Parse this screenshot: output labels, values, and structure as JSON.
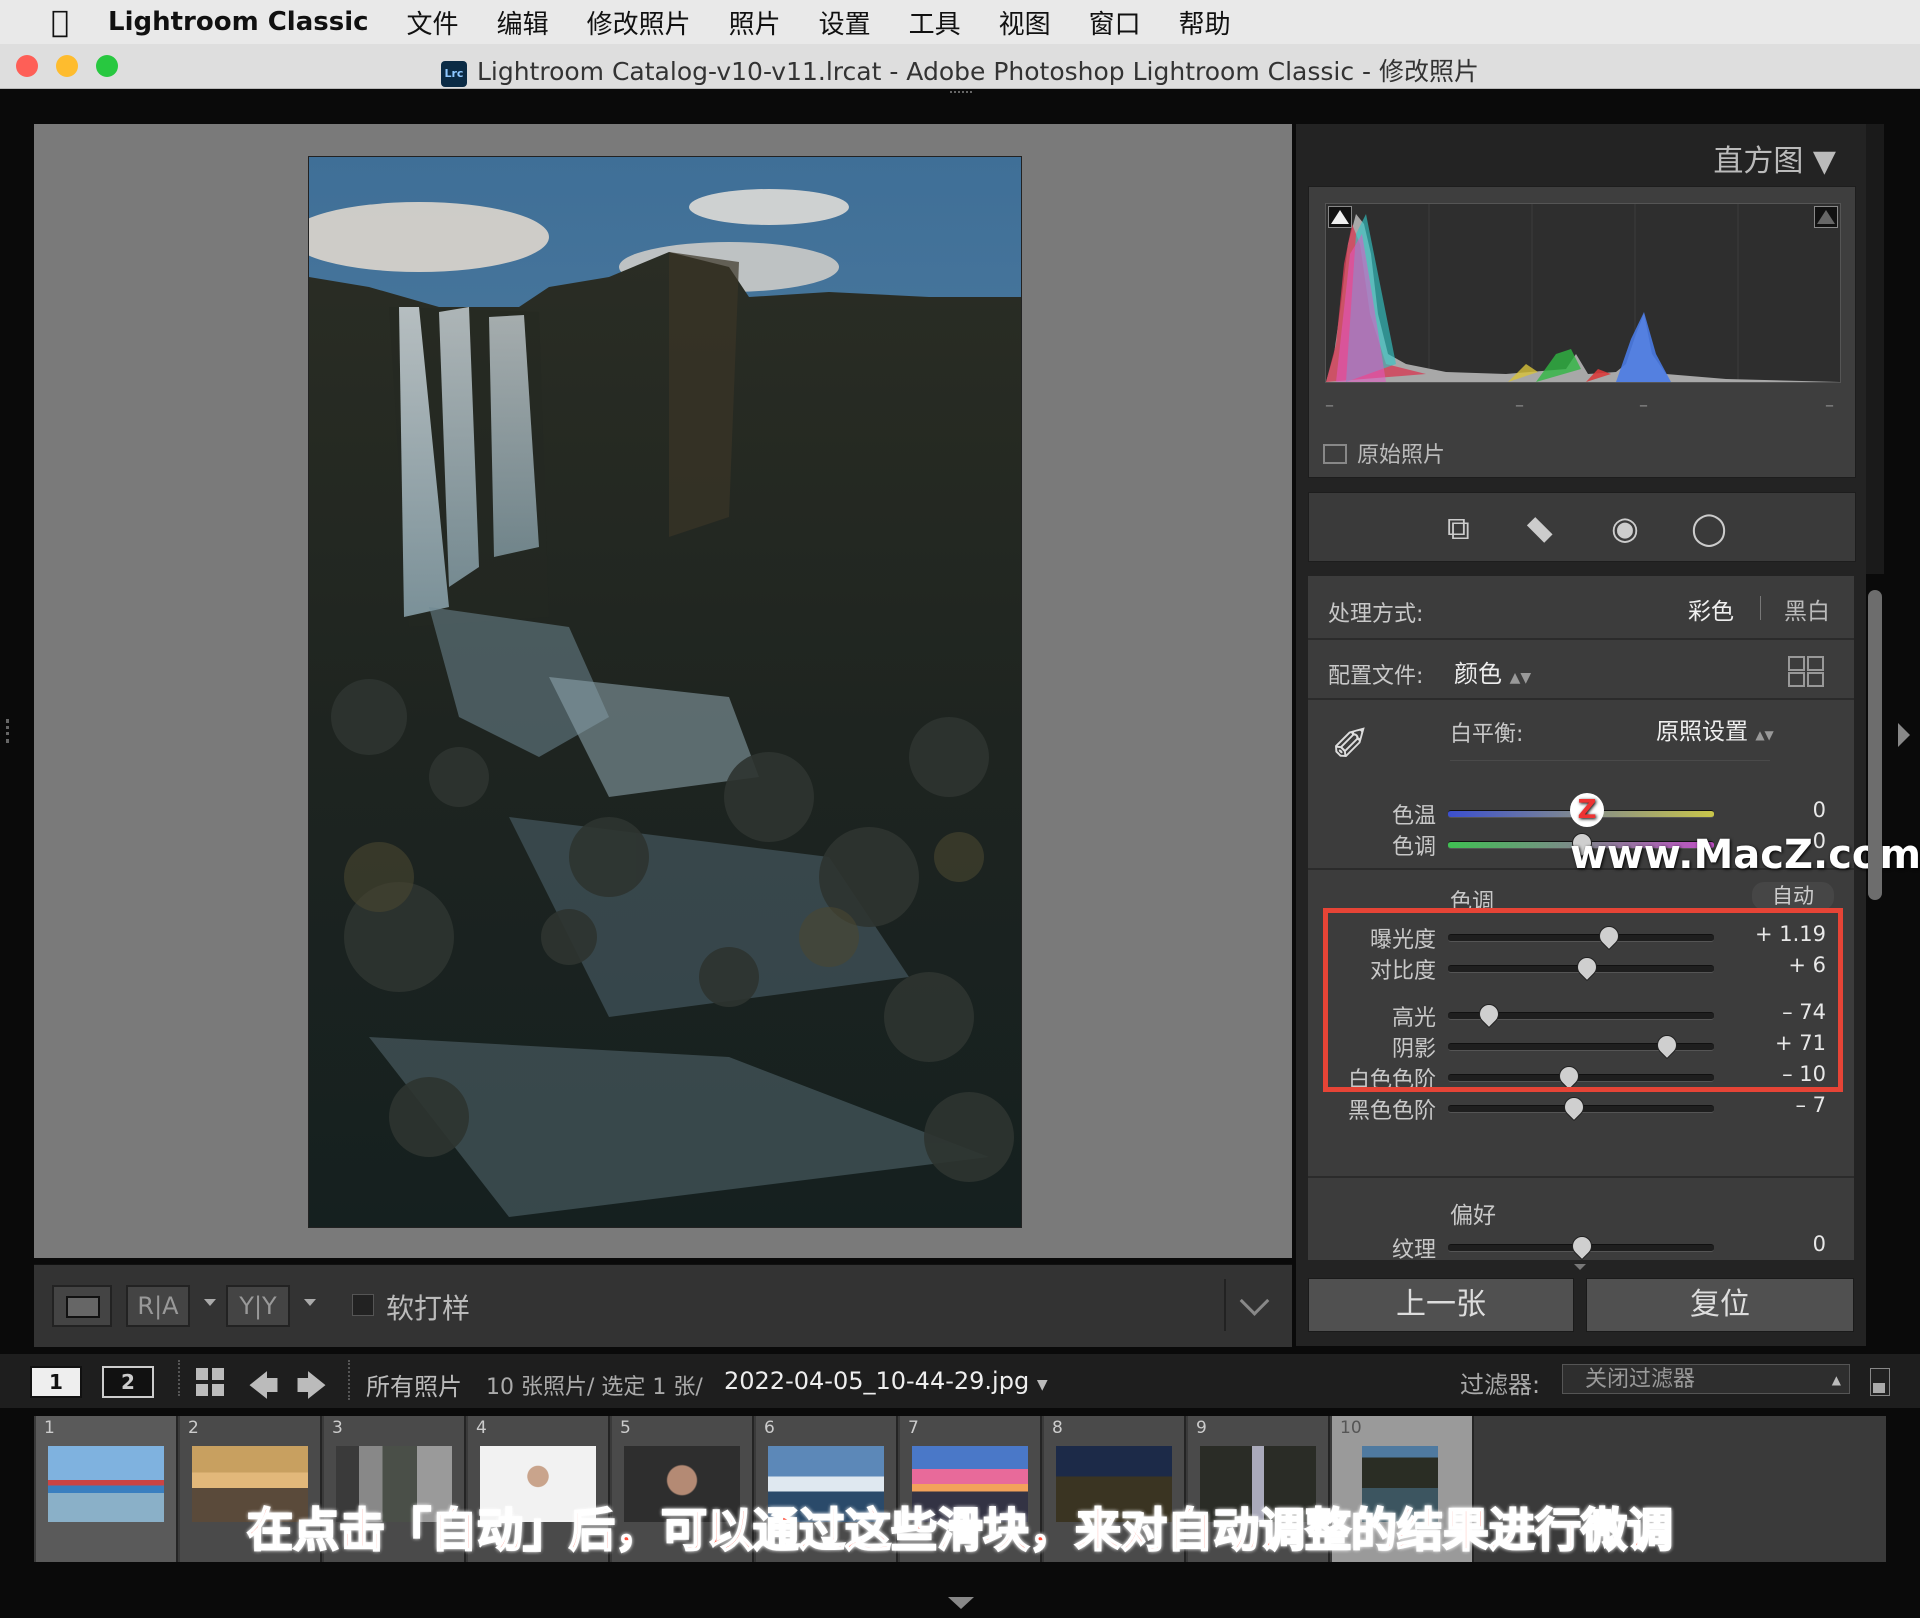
{
  "menubar": {
    "app_name": "Lightroom Classic",
    "items": [
      "文件",
      "编辑",
      "修改照片",
      "照片",
      "设置",
      "工具",
      "视图",
      "窗口",
      "帮助"
    ]
  },
  "window": {
    "icon_text": "Lrc",
    "title": "Lightroom Catalog-v10-v11.lrcat - Adobe Photoshop Lightroom Classic - 修改照片"
  },
  "right_panel": {
    "histogram_title": "直方图",
    "original_photo_label": "原始照片",
    "treatment": {
      "label": "处理方式:",
      "color": "彩色",
      "bw": "黑白"
    },
    "profile": {
      "label": "配置文件:",
      "value": "颜色"
    },
    "white_balance": {
      "label": "白平衡:",
      "value": "原照设置"
    },
    "wb_sliders": [
      {
        "label": "色温",
        "value": "0",
        "pos": 0.5
      },
      {
        "label": "色调",
        "value": "0",
        "pos": 0.5
      }
    ],
    "tone_header": "色调",
    "tone_auto": "自动",
    "tone_sliders": [
      {
        "label": "曝光度",
        "value": "+ 1.19",
        "pos": 0.6
      },
      {
        "label": "对比度",
        "value": "+ 6",
        "pos": 0.52
      },
      {
        "label": "高光",
        "value": "– 74",
        "pos": 0.15
      },
      {
        "label": "阴影",
        "value": "+ 71",
        "pos": 0.82
      },
      {
        "label": "白色色阶",
        "value": "– 10",
        "pos": 0.45
      },
      {
        "label": "黑色色阶",
        "value": "– 7",
        "pos": 0.47
      }
    ],
    "presence_header": "偏好",
    "presence_sliders": [
      {
        "label": "纹理",
        "value": "0",
        "pos": 0.5
      }
    ],
    "prev_button": "上一张",
    "reset_button": "复位"
  },
  "viewer_toolbar": {
    "compare_ra": "R|A",
    "compare_yy": "Y|Y",
    "soft_proof_label": "软打样"
  },
  "filmstrip_bar": {
    "view1": "1",
    "view2": "2",
    "source": "所有照片",
    "info": "10 张照片/ 选定 1 张/",
    "filename": "2022-04-05_10-44-29.jpg",
    "filter_label": "过滤器:",
    "filter_value": "关闭过滤器"
  },
  "filmstrip": {
    "numbers": [
      "1",
      "2",
      "3",
      "4",
      "5",
      "6",
      "7",
      "8",
      "9",
      "10"
    ]
  },
  "caption": "在点击「自动」后，可以通过这些滑块，来对自动调整的结果进行微调",
  "watermark": {
    "badge": "Z",
    "text": "www.MacZ.com"
  }
}
